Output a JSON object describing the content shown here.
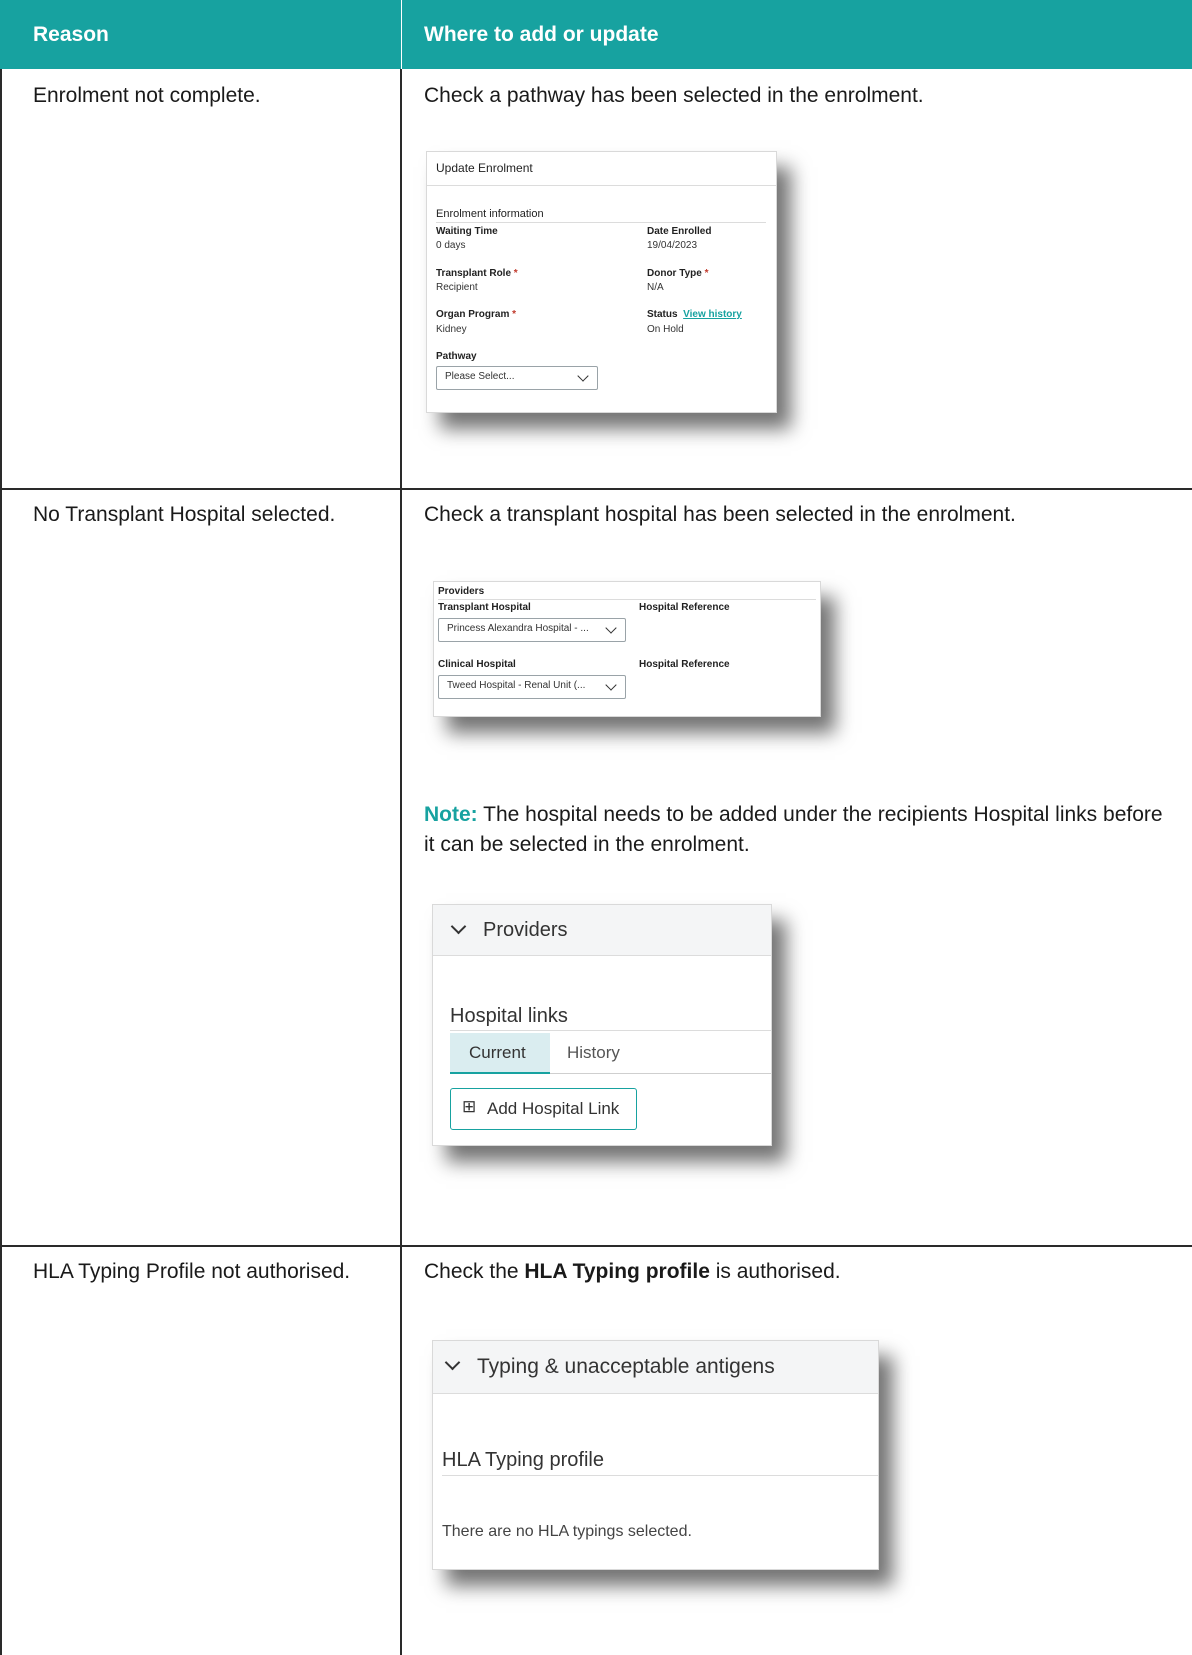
{
  "header": {
    "col1": "Reason",
    "col2": "Where to add or update"
  },
  "rows": [
    {
      "reason": "Enrolment not complete.",
      "description": "Check a pathway has been selected in the enrolment.",
      "panel": {
        "title": "Update Enrolment",
        "section": "Enrolment information",
        "waiting_time_label": "Waiting Time",
        "waiting_time_value": "0 days",
        "date_enrolled_label": "Date Enrolled",
        "date_enrolled_value": "19/04/2023",
        "transplant_role_label": "Transplant Role",
        "transplant_role_value": "Recipient",
        "donor_type_label": "Donor Type",
        "donor_type_value": "N/A",
        "organ_program_label": "Organ Program",
        "organ_program_value": "Kidney",
        "status_label": "Status",
        "view_history": "View history",
        "status_value": "On Hold",
        "required_mark": "*",
        "pathway_label": "Pathway",
        "pathway_placeholder": "Please Select..."
      }
    },
    {
      "reason": "No Transplant Hospital selected.",
      "description": "Check a transplant hospital has been selected in the enrolment.",
      "panel": {
        "title": "Providers",
        "transplant_hospital_label": "Transplant Hospital",
        "transplant_hospital_value": "Princess Alexandra Hospital - ...",
        "hospital_reference_label": "Hospital Reference",
        "clinical_hospital_label": "Clinical Hospital",
        "clinical_hospital_value": "Tweed Hospital - Renal Unit (...",
        "hospital_reference_label_2": "Hospital Reference"
      },
      "note_label": "Note:",
      "note_text": " The hospital needs to be added under the recipients Hospital links before it can be selected in the enrolment.",
      "panel2": {
        "accordion_title": "Providers",
        "section": "Hospital links",
        "tab_current": "Current",
        "tab_history": "History",
        "add_button": "Add Hospital Link",
        "add_icon": "⊞"
      }
    },
    {
      "reason": "HLA Typing Profile not authorised.",
      "description_prefix": "Check the ",
      "description_bold": "HLA Typing profile",
      "description_suffix": " is authorised.",
      "panel": {
        "accordion_title": "Typing & unacceptable antigens",
        "section": "HLA Typing profile",
        "empty_text": "There are no HLA typings selected."
      }
    }
  ]
}
